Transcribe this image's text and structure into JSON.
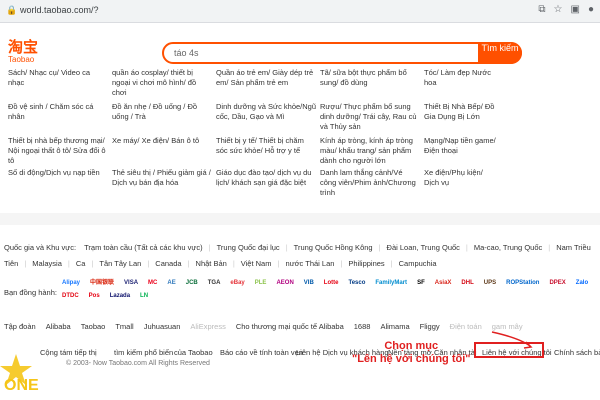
{
  "browser": {
    "url": "world.taobao.com/?"
  },
  "logo": {
    "cn": "淘宝",
    "en": "Taobao"
  },
  "search": {
    "value": "táo 4s",
    "button": "Tìm kiếm"
  },
  "categories": [
    [
      "Sách/ Nhạc cụ/ Video ca nhạc",
      "quần áo cosplay/ thiết bị ngoại vi chơi mô hình/ đồ chơi",
      "Quần áo trẻ em/ Giày dép trẻ em/ Sản phẩm trẻ em",
      "Tã/ sữa bột thực phẩm bổ sung/ đồ dùng",
      "Tóc/ Làm đẹp Nước hoa"
    ],
    [
      "Đồ vệ sinh / Chăm sóc cá nhân",
      "Đồ ăn nhẹ / Đồ uống / Đồ uống / Trà",
      "Dinh dưỡng và Sức khỏe/Ngũ cốc, Dầu, Gạo và Mì",
      "Rượu/ Thực phẩm bổ sung dinh dưỡng/ Trái cây, Rau củ và Thủy sản",
      "Thiết Bị Nhà Bếp/ Đồ Gia Dụng Bị Lớn"
    ],
    [
      "Thiết bị nhà bếp thương mại/ Nội ngoại thất ô tô/ Sửa đổi ô tô",
      "Xe máy/ Xe điện/ Bán ô tô",
      "Thiết bị y tế/ Thiết bị chăm sóc sức khỏe/ Hỗ trợ y tế",
      "Kính áp tròng, kính áp tròng màu/ khẩu trang/ sản phẩm dành cho người lớn",
      "Mạng/Nạp tiền game/ Điện thoại"
    ],
    [
      "Số di động/Dịch vụ nạp tiền",
      "Thẻ siêu thị / Phiếu giảm giá / Dịch vụ bán địa hóa",
      "Giáo dục đào tạo/ dịch vụ du lịch/ khách sạn giá đặc biệt",
      "Danh lam thắng cảnh/Vé công viên/Phim ảnh/Chương trình",
      "Xe điện/Phụ kiện/ Dịch vụ"
    ]
  ],
  "countries": {
    "label": "Quốc gia và Khu vực:",
    "items": [
      "Trạm toàn cầu (Tất cả các khu vực)",
      "Trung Quốc đại lục",
      "Trung Quốc Hồng Kông",
      "Đài Loan, Trung Quốc",
      "Ma-cao, Trung Quốc",
      "Nam Triều Tiên",
      "Malaysia",
      "Ca",
      "Tân Tây Lan",
      "Canada",
      "Nhật Bản",
      "Việt Nam",
      "nước Thái Lan",
      "Philippines",
      "Campuchia"
    ]
  },
  "partners": {
    "label": "Bạn đồng hành:",
    "logos": [
      {
        "name": "Alipay",
        "color": "#1677ff"
      },
      {
        "name": "中国银联",
        "color": "#d81e06"
      },
      {
        "name": "VISA",
        "color": "#1a1f71"
      },
      {
        "name": "MC",
        "color": "#eb001b"
      },
      {
        "name": "AE",
        "color": "#2e77bb"
      },
      {
        "name": "JCB",
        "color": "#0b6e3a"
      },
      {
        "name": "TGA",
        "color": "#333333"
      },
      {
        "name": "eBay",
        "color": "#e53238"
      },
      {
        "name": "PLE",
        "color": "#8bc34a"
      },
      {
        "name": "AEON",
        "color": "#b1007f"
      },
      {
        "name": "VIB",
        "color": "#0059a9"
      },
      {
        "name": "Lotte",
        "color": "#e60012"
      },
      {
        "name": "Tesco",
        "color": "#003a84"
      },
      {
        "name": "FamilyMart",
        "color": "#008ccf"
      },
      {
        "name": "SF",
        "color": "#000000"
      },
      {
        "name": "AsiaX",
        "color": "#d9261c"
      },
      {
        "name": "DHL",
        "color": "#d40511"
      },
      {
        "name": "UPS",
        "color": "#5e3a1a"
      },
      {
        "name": "ROPStation",
        "color": "#0066cc"
      },
      {
        "name": "DPEX",
        "color": "#c8102e"
      },
      {
        "name": "Zalo",
        "color": "#0068ff"
      },
      {
        "name": "DTDC",
        "color": "#e30613"
      },
      {
        "name": "Pos",
        "color": "#e60012"
      },
      {
        "name": "Lazada",
        "color": "#0f146d"
      },
      {
        "name": "LN",
        "color": "#00b14f"
      }
    ]
  },
  "bottom_links": [
    "Tập đoàn",
    "Alibaba",
    "Taobao",
    "Tmall",
    "Juhuasuan",
    "AliExpress",
    "Cho thương mại quốc tế Alibaba",
    "1688",
    "Alimama",
    "Fliggy",
    "Điện toán",
    "gam mây"
  ],
  "footer": {
    "links": [
      "Cộng tám tiếp thị",
      "tìm kiếm phổ biến",
      "của Taobao",
      "Báo cáo về tính toàn vẹn",
      "Liên hệ Dịch vụ khách hàng",
      "Nền tảng mở",
      "Căn nhân tài",
      "Liên hệ với chúng tôi",
      "Chính sách bảo m"
    ],
    "copyright": "© 2003-   Now    Taobao.com All Rights Reserved"
  },
  "annotation": {
    "line1": "Chọn mục",
    "line2": "\"Lên hệ với chúng tôi\"",
    "color": "#e02020"
  },
  "watermark": {
    "text": "ONE"
  }
}
